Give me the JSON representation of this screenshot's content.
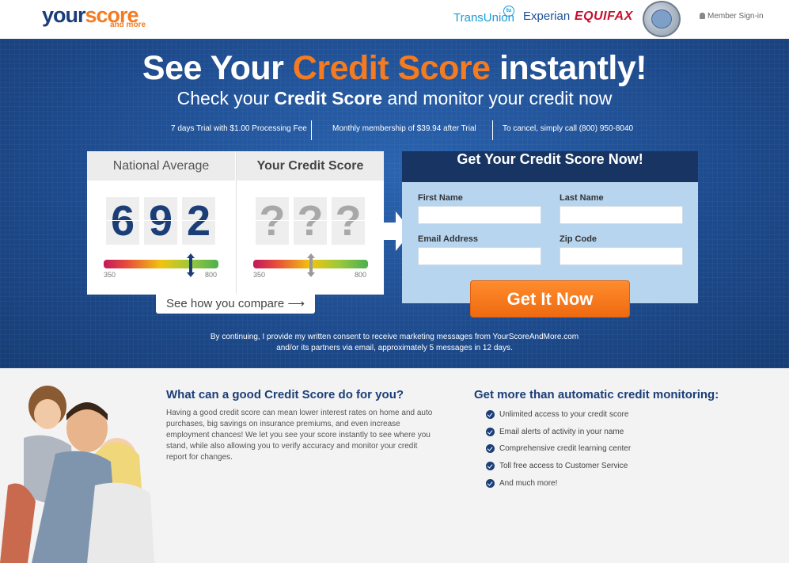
{
  "header": {
    "logo_main_a": "your",
    "logo_main_b": "score",
    "logo_sub": "and more",
    "bureaus": [
      "TransUnion",
      "Experian",
      "EQUIFAX"
    ],
    "transunion_badge": "tu",
    "member_signin": "Member Sign-in"
  },
  "hero": {
    "title_pre": "See Your ",
    "title_highlight": "Credit Score",
    "title_post": " instantly!",
    "subtitle_pre": "Check your ",
    "subtitle_bold": "Credit Score",
    "subtitle_post": " and monitor your credit now",
    "terms": [
      "7 days Trial with $1.00 Processing Fee",
      "Monthly membership of $39.94 after Trial",
      "To cancel, simply call (800) 950-8040"
    ],
    "consent_line1": "By continuing, I provide my written consent to receive marketing messages from YourScoreAndMore.com",
    "consent_line2": "and/or its partners via email, approximately 5 messages in 12 days."
  },
  "score_panel": {
    "national_label": "National Average",
    "your_label": "Your Credit Score",
    "national_digits": [
      "6",
      "9",
      "2"
    ],
    "your_digits": [
      "?",
      "?",
      "?"
    ],
    "gauge_min": "350",
    "gauge_max": "800",
    "national_score_value": 692,
    "your_score_needle_fraction": 0.5,
    "compare_label": "See how you compare",
    "compare_arrow": "⟶"
  },
  "form": {
    "title": "Get Your Credit Score Now!",
    "fields": {
      "first_name": {
        "label": "First Name",
        "value": ""
      },
      "last_name": {
        "label": "Last Name",
        "value": ""
      },
      "email": {
        "label": "Email Address",
        "value": ""
      },
      "zip": {
        "label": "Zip Code",
        "value": ""
      }
    },
    "submit_label": "Get It Now"
  },
  "lower": {
    "left_heading": "What can a good Credit Score do for you?",
    "left_paragraph": "Having a good credit score can mean lower interest rates on home and auto purchases, big savings on insurance premiums, and even increase employment chances! We let you see your score instantly to see where you stand, while also allowing you to verify accuracy and monitor your credit report for changes.",
    "right_heading": "Get more than automatic credit monitoring:",
    "benefits": [
      "Unlimited access to your credit score",
      "Email alerts of activity in your name",
      "Comprehensive credit learning center",
      "Toll free access to Customer Service",
      "And much more!"
    ]
  },
  "colors": {
    "navy": "#1b3e78",
    "orange": "#f47b20",
    "hero_blue": "#1e4f95",
    "form_bg": "#b7d5ef",
    "form_header": "#173462"
  }
}
